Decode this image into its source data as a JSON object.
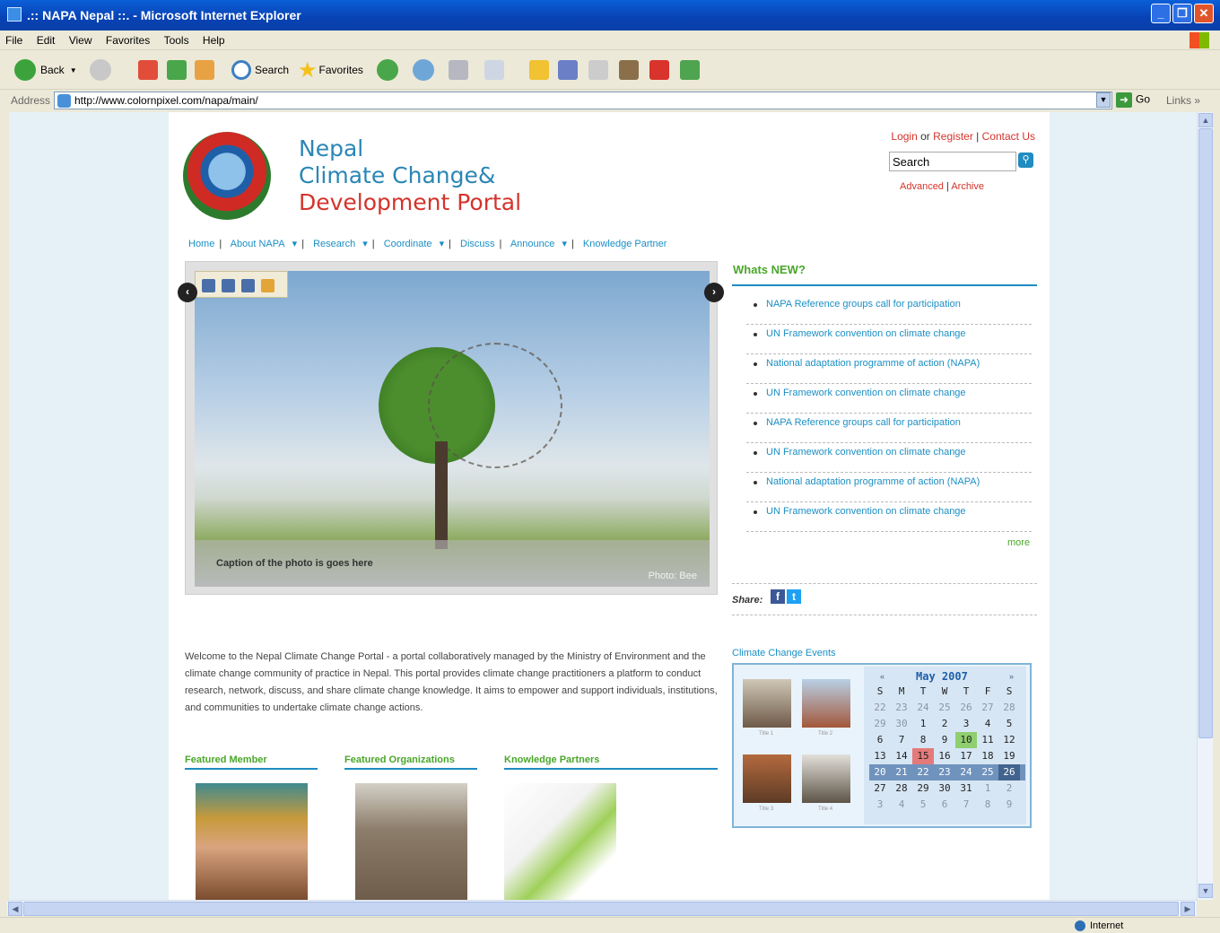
{
  "window": {
    "title": ".:: NAPA Nepal ::. - Microsoft Internet Explorer"
  },
  "menu": [
    "File",
    "Edit",
    "View",
    "Favorites",
    "Tools",
    "Help"
  ],
  "toolbar": {
    "back": "Back",
    "search": "Search",
    "favorites": "Favorites"
  },
  "address": {
    "label": "Address",
    "url": "http://www.colornpixel.com/napa/main/",
    "go": "Go",
    "links": "Links"
  },
  "status": {
    "zone": "Internet"
  },
  "site": {
    "title_line1": "Nepal",
    "title_line2": "Climate Change&",
    "title_line3": "Development Portal",
    "login": "Login",
    "or": "or",
    "register": "Register",
    "sep": "|",
    "contact": "Contact Us",
    "search_value": "Search",
    "advanced": "Advanced",
    "archive": "Archive"
  },
  "nav": [
    "Home",
    "About NAPA",
    "Research",
    "Coordinate",
    "Discuss",
    "Announce",
    "Knowledge Partner"
  ],
  "slider": {
    "caption": "Caption of the photo is goes here",
    "credit": "Photo: Bee"
  },
  "whats_new": {
    "title": "Whats NEW?",
    "items": [
      "NAPA Reference groups call for participation",
      "UN Framework convention on climate change",
      "National adaptation programme of action (NAPA)",
      "UN Framework convention on climate change",
      "NAPA Reference groups call for participation",
      "UN Framework convention on climate change",
      "National adaptation programme of action (NAPA)",
      "UN Framework convention on climate change"
    ],
    "more": "more"
  },
  "share": {
    "label": "Share:",
    "fb": "f",
    "tw": "t"
  },
  "welcome": "Welcome to the Nepal Climate Change Portal - a portal collaboratively managed by the Ministry of Environment and the climate change community of practice in Nepal. This portal provides climate change practitioners a platform to conduct research, network, discuss, and share climate change knowledge. It aims to empower and support individuals, institutions, and communities to undertake climate change actions.",
  "featured": {
    "member": "Featured Member",
    "orgs": "Featured Organizations",
    "partners": "Knowledge Partners"
  },
  "events": {
    "title": "Climate Change Events",
    "thumb_caps": [
      "Title 1",
      "Title 2",
      "Title 3",
      "Title 4"
    ],
    "calendar": {
      "prev": "«",
      "next": "»",
      "month": "May 2007",
      "days": [
        "S",
        "M",
        "T",
        "W",
        "T",
        "F",
        "S"
      ],
      "weeks": [
        [
          "22",
          "23",
          "24",
          "25",
          "26",
          "27",
          "28"
        ],
        [
          "29",
          "30",
          "1",
          "2",
          "3",
          "4",
          "5"
        ],
        [
          "6",
          "7",
          "8",
          "9",
          "10",
          "11",
          "12"
        ],
        [
          "13",
          "14",
          "15",
          "16",
          "17",
          "18",
          "19"
        ],
        [
          "20",
          "21",
          "22",
          "23",
          "24",
          "25",
          "26"
        ],
        [
          "27",
          "28",
          "29",
          "30",
          "31",
          "1",
          "2"
        ],
        [
          "3",
          "4",
          "5",
          "6",
          "7",
          "8",
          "9"
        ]
      ]
    }
  }
}
